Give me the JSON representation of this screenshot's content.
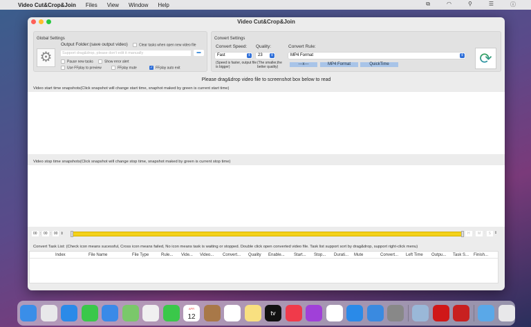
{
  "menubar": {
    "app": "Video Cut&Crop&Join",
    "items": [
      "Files",
      "View",
      "Window",
      "Help"
    ]
  },
  "window": {
    "title": "Video Cut&Crop&Join"
  },
  "global_settings": {
    "title": "Global Settings",
    "output_folder_label": "Output Folder:(save output video)",
    "clear_tasks_label": "Clear tasks when open new video file",
    "clear_tasks_checked": false,
    "folder_placeholder": "Support drag&drop, please don't edit it manually",
    "pause_new_tasks": "Pause new tasks",
    "show_error_alert": "Show error alert",
    "use_ffplay": "Use FFplay to preview",
    "ffplay_mute": "FFplay mute",
    "ffplay_auto_exit": "FFplay auto exit",
    "ffplay_auto_exit_checked": true
  },
  "convert_settings": {
    "title": "Convert Settings",
    "speed_label": "Convert Speed:",
    "speed_value": "Fast",
    "speed_hint": "(Speed is faster, output file is bigger)",
    "quality_label": "Quality:",
    "quality_value": "23",
    "quality_hint": "(The smaller,the better quality)",
    "rule_label": "Convert Rule:",
    "rule_value": "MP4 Format",
    "presets": [
      "---x---",
      "MP4 Format",
      "QuickTime"
    ]
  },
  "main": {
    "drop_hint": "Please drag&drop video file to screenshot box below to read",
    "start_label": "Video start time snapshots(Click snapshot will change start time, snaphot maked by green is current start time)",
    "stop_label": "Video stop time snapshots(Click snapshot will change stop time, snapshot maked by green is current stop time)"
  },
  "timeline": {
    "h": "00",
    "m": "00",
    "s": "00",
    "end_h": "H",
    "end_m": "M",
    "end_s": "S",
    "range": [
      0,
      1
    ]
  },
  "tasks": {
    "label": "Convert Task List: (Check icon means sucessful,  Cross icon means failed, No icon means task is waiting or stopped. Double click open converted video file. Task list support sort by drag&drop, support right-click menu)",
    "columns": [
      "Index",
      "File Name",
      "File Type",
      "Rule...",
      "Vide...",
      "Video...",
      "Convert...",
      "Quality",
      "Enable...",
      "Start...",
      "Stop...",
      "Durati...",
      "Mute",
      "Convert...",
      "Left Time",
      "Outpu...",
      "Task S...",
      "Finish..."
    ]
  },
  "dock": {
    "calendar_month": "APR",
    "calendar_day": "12",
    "tv": "tv",
    "apps": [
      "finder",
      "launchpad",
      "safari",
      "messages",
      "mail",
      "maps",
      "photos",
      "facetime",
      "calendar",
      "contacts",
      "reminders",
      "notes",
      "tv",
      "music",
      "podcasts",
      "news",
      "app-store",
      "altitude",
      "system-preferences",
      "preview",
      "stethoscope-app",
      "video-cut-crop-join",
      "downloads",
      "trash"
    ]
  }
}
